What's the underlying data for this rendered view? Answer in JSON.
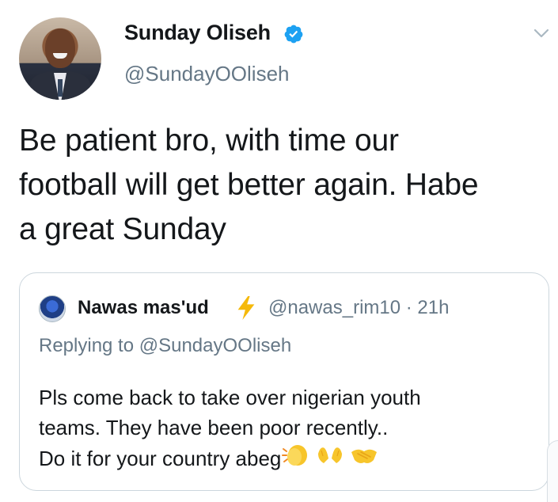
{
  "author": {
    "display_name": "Sunday Oliseh",
    "handle": "@SundayOOliseh",
    "verified": true,
    "avatar_icon": "profile-photo"
  },
  "tweet": {
    "lines": [
      "Be patient bro, with time our",
      "football will get better again. Habe",
      "a great Sunday"
    ]
  },
  "quoted_tweet": {
    "display_name": "Nawas mas'ud",
    "name_emoji": "lightning-bolt-icon",
    "handle_time": "@nawas_rim10 · 21h",
    "replying_to": "Replying to @SundayOOliseh",
    "lines": [
      "Pls come back to take over nigerian youth",
      "teams. They have been poor recently..",
      "Do it for your country abeg"
    ],
    "trailing_emojis": [
      "clapping-hands-icon",
      "raising-hands-icon",
      "handshake-icon"
    ]
  },
  "colors": {
    "text_primary": "#14171a",
    "text_secondary": "#657786",
    "verified_blue": "#1da1f2",
    "border": "#ccd6dd",
    "bolt_yellow": "#f5b90a",
    "emoji_yellow": "#f7c52b"
  }
}
